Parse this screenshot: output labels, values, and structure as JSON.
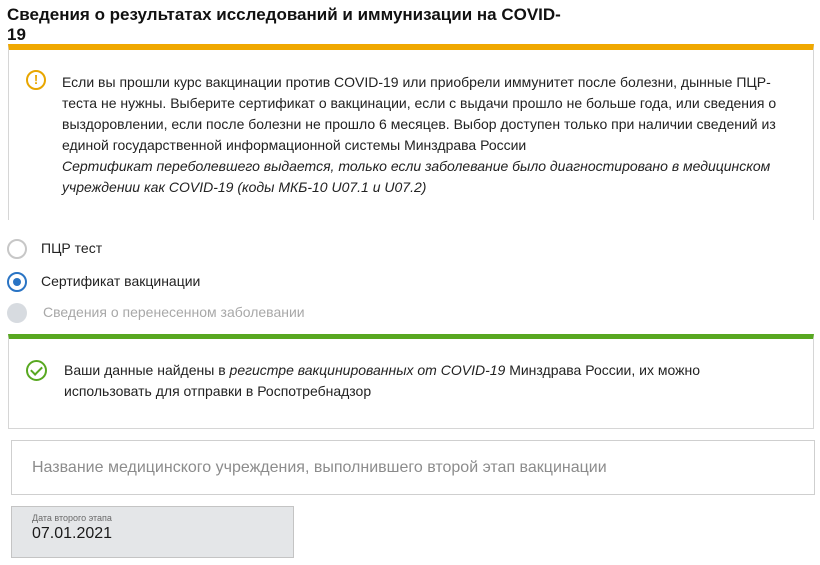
{
  "page": {
    "title": "Сведения о результатах исследований и иммунизации на COVID-19"
  },
  "warning": {
    "icon": "exclamation-circle-icon",
    "text": "Если вы прошли курс вакцинации против COVID-19 или приобрели иммунитет после болезни, дынные ПЦР-теста не нужны. Выберите сертификат о вакцинации, если с выдачи прошло не больше года, или сведения о выздоровлении, если после болезни не прошло 6 месяцев. Выбор доступен только при наличии сведений из единой государственной информационной системы Минздрава России",
    "note": "Сертификат переболевшего выдается, только если заболевание было диагностировано в медицинском учреждении как COVID-19 (коды МКБ-10 U07.1 и U07.2)",
    "accent_color": "#f0a800"
  },
  "options": {
    "items": [
      {
        "label": "ПЦР тест",
        "state": "unchecked"
      },
      {
        "label": "Сертификат вакцинации",
        "state": "checked"
      },
      {
        "label": "Сведения о перенесенном заболевании",
        "state": "disabled"
      }
    ],
    "checked_color": "#2a74c4"
  },
  "success": {
    "icon": "check-circle-icon",
    "text_before": "Ваши данные найдены в ",
    "text_italic": "регистре вакцинированных от COVID-19",
    "text_after": " Минздрава России, их можно использовать для отправки в Роспотребнадзор",
    "accent_color": "#58a821"
  },
  "medical_institution": {
    "placeholder": "Название медицинского учреждения, выполнившего второй этап вакцинации",
    "value": ""
  },
  "second_stage_date": {
    "label": "Дата второго этапа",
    "value": "07.01.2021"
  }
}
